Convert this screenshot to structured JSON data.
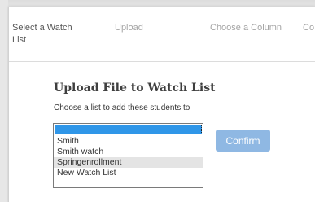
{
  "steps": [
    {
      "label": "Select a Watch List",
      "state": "active"
    },
    {
      "label": "Upload",
      "state": "inactive"
    },
    {
      "label": "Choose a Column",
      "state": "inactive"
    },
    {
      "label": "Co",
      "state": "inactive"
    }
  ],
  "panel": {
    "title": "Upload File to Watch List",
    "prompt": "Choose a list to add these students to"
  },
  "watch_list_select": {
    "selected_value": "",
    "options": [
      "",
      "Smith",
      "Smith watch",
      "Springenrollment",
      "New Watch List"
    ],
    "hovered_option": "Springenrollment"
  },
  "confirm_button": {
    "label": "Confirm",
    "state": "disabled"
  },
  "colors": {
    "selected_option_bg": "#2f96e8",
    "hovered_option_bg": "#e4e4e4",
    "confirm_bg": "#8fb8e3",
    "active_step_text": "#555555",
    "inactive_step_text": "#a4a4a4"
  }
}
